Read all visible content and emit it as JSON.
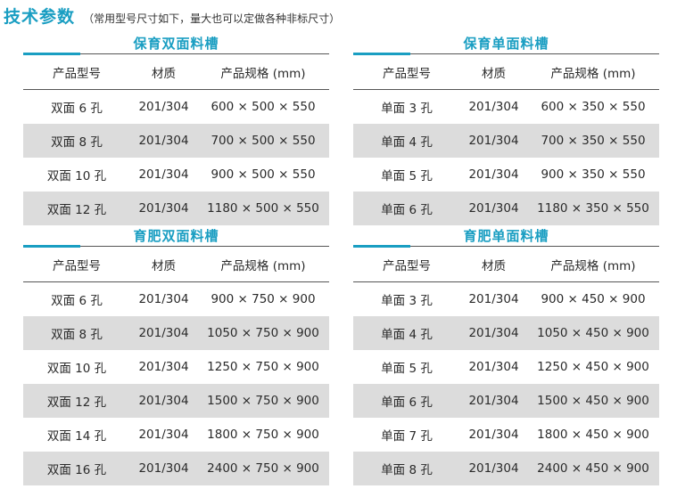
{
  "page": {
    "title": "技术参数",
    "note": "（常用型号尺寸如下，量大也可以定做各种非标尺寸）"
  },
  "columns": [
    "产品型号",
    "材质",
    "产品规格 (mm)"
  ],
  "sections": [
    {
      "title": "保育双面料槽",
      "rows": [
        [
          "双面 6 孔",
          "201/304",
          "600 × 500 × 550"
        ],
        [
          "双面 8 孔",
          "201/304",
          "700 × 500 × 550"
        ],
        [
          "双面 10 孔",
          "201/304",
          "900 × 500 × 550"
        ],
        [
          "双面 12 孔",
          "201/304",
          "1180 × 500 × 550"
        ]
      ]
    },
    {
      "title": "保育单面料槽",
      "rows": [
        [
          "单面 3 孔",
          "201/304",
          "600 × 350 × 550"
        ],
        [
          "单面 4 孔",
          "201/304",
          "700 × 350 × 550"
        ],
        [
          "单面 5 孔",
          "201/304",
          "900 × 350 × 550"
        ],
        [
          "单面 6 孔",
          "201/304",
          "1180 × 350 × 550"
        ]
      ]
    },
    {
      "title": "育肥双面料槽",
      "rows": [
        [
          "双面 6 孔",
          "201/304",
          "900 × 750 × 900"
        ],
        [
          "双面 8 孔",
          "201/304",
          "1050 × 750 × 900"
        ],
        [
          "双面 10 孔",
          "201/304",
          "1250 × 750 × 900"
        ],
        [
          "双面 12 孔",
          "201/304",
          "1500 × 750 × 900"
        ],
        [
          "双面 14 孔",
          "201/304",
          "1800 × 750 × 900"
        ],
        [
          "双面 16 孔",
          "201/304",
          "2400 × 750 × 900"
        ]
      ]
    },
    {
      "title": "育肥单面料槽",
      "rows": [
        [
          "单面 3 孔",
          "201/304",
          "900 × 450 × 900"
        ],
        [
          "单面 4 孔",
          "201/304",
          "1050 × 450 × 900"
        ],
        [
          "单面 5 孔",
          "201/304",
          "1250 × 450 × 900"
        ],
        [
          "单面 6 孔",
          "201/304",
          "1500 × 450 × 900"
        ],
        [
          "单面 7 孔",
          "201/304",
          "1800 × 450 × 900"
        ],
        [
          "单面 8 孔",
          "201/304",
          "2400 × 450 × 900"
        ]
      ]
    }
  ],
  "colors": {
    "accent": "#1a9ec2",
    "row_shade": "#dcdcdc",
    "rule": "#555555"
  }
}
